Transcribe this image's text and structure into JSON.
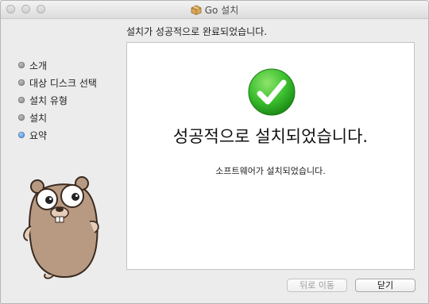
{
  "window": {
    "title": "Go 설치"
  },
  "header": {
    "subtitle": "설치가 성공적으로 완료되었습니다."
  },
  "sidebar": {
    "steps": [
      {
        "label": "소개",
        "state": "done"
      },
      {
        "label": "대상 디스크 선택",
        "state": "done"
      },
      {
        "label": "설치 유형",
        "state": "done"
      },
      {
        "label": "설치",
        "state": "done"
      },
      {
        "label": "요약",
        "state": "active"
      }
    ]
  },
  "main": {
    "headline": "성공적으로 설치되었습니다.",
    "message": "소프트웨어가 설치되었습니다."
  },
  "buttons": {
    "back_label": "뒤로 이동",
    "close_label": "닫기"
  },
  "colors": {
    "success_green": "#3bbf2e",
    "active_step": "#2c7be0"
  }
}
